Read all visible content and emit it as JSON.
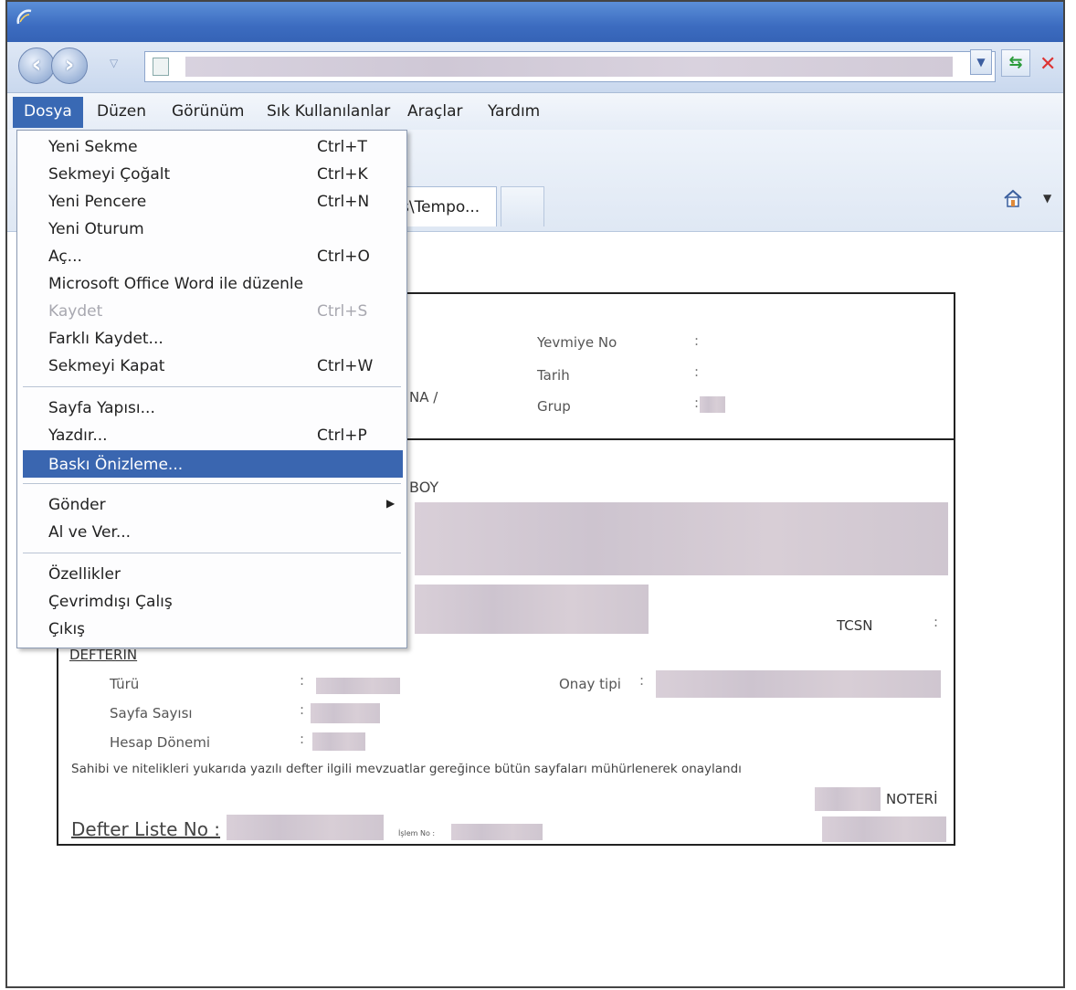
{
  "menubar": {
    "dosya": "Dosya",
    "duzen": "Düzen",
    "gorunum": "Görünüm",
    "sik": "Sık Kullanılanlar",
    "araclar": "Araçlar",
    "yardim": "Yardım"
  },
  "tab": {
    "label": "s\\Tempo..."
  },
  "dosya_menu": {
    "items": [
      {
        "label": "Yeni Sekme",
        "shortcut": "Ctrl+T"
      },
      {
        "label": "Sekmeyi Çoğalt",
        "shortcut": "Ctrl+K"
      },
      {
        "label": "Yeni Pencere",
        "shortcut": "Ctrl+N"
      },
      {
        "label": "Yeni Oturum",
        "shortcut": ""
      },
      {
        "label": "Aç...",
        "shortcut": "Ctrl+O"
      },
      {
        "label": "Microsoft Office Word ile düzenle",
        "shortcut": ""
      },
      {
        "label": "Kaydet",
        "shortcut": "Ctrl+S",
        "disabled": true
      },
      {
        "label": "Farklı Kaydet...",
        "shortcut": ""
      },
      {
        "label": "Sekmeyi Kapat",
        "shortcut": "Ctrl+W"
      },
      {
        "label": "Sayfa Yapısı...",
        "shortcut": ""
      },
      {
        "label": "Yazdır...",
        "shortcut": "Ctrl+P"
      },
      {
        "label": "Baskı Önizleme...",
        "shortcut": "",
        "highlighted": true
      },
      {
        "label": "Gönder",
        "shortcut": "",
        "submenu": true
      },
      {
        "label": "Al ve Ver...",
        "shortcut": ""
      },
      {
        "label": "Özellikler",
        "shortcut": ""
      },
      {
        "label": "Çevrimdışı Çalış",
        "shortcut": ""
      },
      {
        "label": "Çıkış",
        "shortcut": ""
      }
    ]
  },
  "document": {
    "yevmiye_no": "Yevmiye No",
    "tarih": "Tarih",
    "grup": "Grup",
    "na_fragment": "NA /",
    "boy_fragment": "BOY",
    "tcsn": "TCSN",
    "defterin": "DEFTERİN",
    "turu": "Türü",
    "onay_tipi": "Onay tipi",
    "sayfa_sayisi": "Sayfa Sayısı",
    "hesap_donemi": "Hesap Dönemi",
    "colon": ":",
    "sentence": "Sahibi ve nitelikleri yukarıda yazılı defter ilgili mevzuatlar gereğince bütün sayfaları mühürlenerek onaylandı",
    "noteri": "NOTERİ",
    "defter_liste_no": "Defter Liste No :",
    "islem_no": "İşlem No :"
  },
  "colors": {
    "menu_highlight": "#3a66b0",
    "titlebar": "#3c6cc0"
  }
}
